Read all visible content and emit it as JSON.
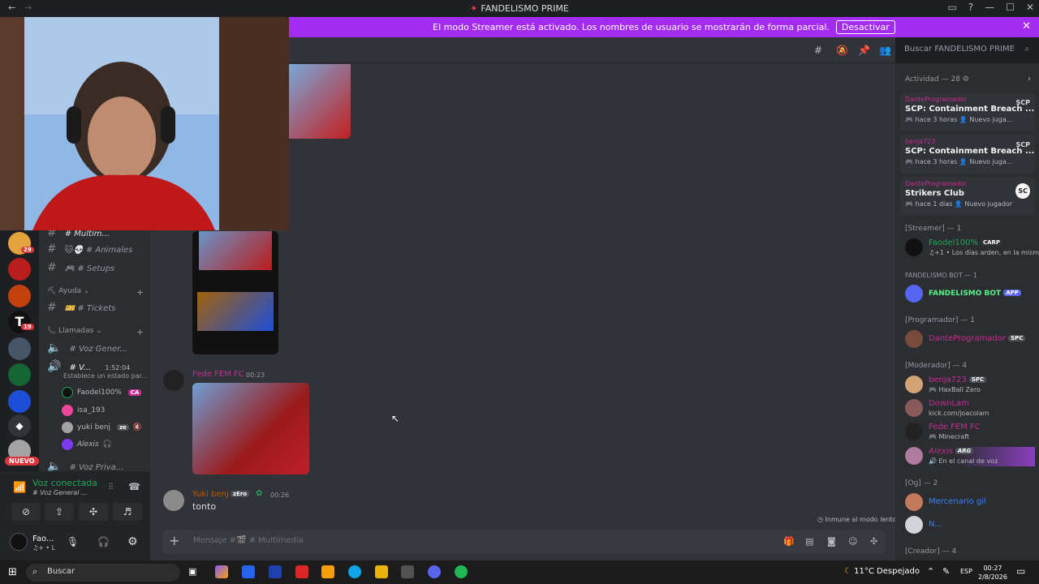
{
  "window": {
    "title": "FANDELISMO PRIME",
    "back": "←",
    "forward": "→",
    "controls": [
      "▭",
      "?",
      "—",
      "☐",
      "✕"
    ]
  },
  "banner": {
    "text": "El modo Streamer está activado. Los nombres de usuario se mostrarán de forma parcial.",
    "button": "Desactivar",
    "close": "✕"
  },
  "servers": {
    "badges": [
      "29",
      "19"
    ],
    "new_label": "NUEVO"
  },
  "channels": {
    "top_partial": "# Multim...",
    "items": [
      {
        "icons": "🐱💀",
        "name": "# Animales"
      },
      {
        "icons": "🎮",
        "name": "# Setups"
      }
    ],
    "category_help": "Ayuda",
    "help_items": [
      {
        "icons": "🎫",
        "name": "# Tickets"
      }
    ],
    "category_calls": "Llamadas",
    "voice_channels": [
      {
        "name": "# Voz Gener...",
        "time": ""
      },
      {
        "name": "# V...",
        "time": "1:52:04"
      }
    ],
    "voice_status_set": "Establece un estado par...",
    "voice_users": [
      {
        "name": "Faodel100%",
        "tag": "CA"
      },
      {
        "name": "isa_193",
        "tag": ""
      },
      {
        "name": "yuki benj",
        "tag": "ze"
      },
      {
        "name": "Alexis",
        "tag": ""
      }
    ],
    "private_channel": "# Voz Priva..."
  },
  "user_panel": {
    "voice_connected": "Voz conectada",
    "voice_channel": "# Voz General ...",
    "self_name": "Fao...",
    "self_status": "♫+ • L"
  },
  "chat": {
    "messages": [
      {
        "author": "Fede FEM FC",
        "time": "00:23",
        "color": "#c72c91"
      },
      {
        "author": "Yuki benj",
        "tag": "zEro",
        "time": "00:26",
        "text": "tonto",
        "color": "#b85b00"
      }
    ],
    "slowmode_notice": "Inmune al modo lento",
    "composer_placeholder": "Mensaje #🎬 # Multimedia",
    "composer_plus": "+"
  },
  "search": {
    "placeholder": "Buscar FANDELISMO PRIME"
  },
  "members": {
    "activity_header": "Actividad — 28 ⚙",
    "activity_cards": [
      {
        "who": "DanteProgramador",
        "game": "SCP: Containment Breach ...",
        "meta": "🎮 hace 3 horas  👤 Nuevo juga...",
        "logo": "SCP"
      },
      {
        "who": "benja723",
        "game": "SCP: Containment Breach ...",
        "meta": "🎮 hace 3 horas  👤 Nuevo juga...",
        "logo": "SCP"
      },
      {
        "who": "DanteProgramador",
        "game": "Strikers Club",
        "meta": "🎮 hace 1 días  👤 Nuevo jugador",
        "logo": "SC"
      }
    ],
    "groups": [
      {
        "label": "[Streamer] — 1"
      },
      {
        "label": "FANDELISMO BOT — 1"
      },
      {
        "label": "[Programador] — 1"
      },
      {
        "label": "[Moderador] — 4"
      },
      {
        "label": "[Og] — 2"
      },
      {
        "label": "[Creador] — 4"
      }
    ],
    "list": [
      {
        "name": "Faodel100%",
        "tag": "CARP",
        "status": "♫+1 • Los días arden, en la misma ...",
        "color": "#23a559"
      },
      {
        "name": "FANDELISMO BOT",
        "tag": "APP",
        "status": "",
        "color": "#57f287"
      },
      {
        "name": "DanteProgramador",
        "tag": "SPC",
        "status": "",
        "color": "#c72c91"
      },
      {
        "name": "benja723",
        "tag": "SPC",
        "status": "🎮 HaxBall Zero",
        "color": "#c72c91"
      },
      {
        "name": "DownLam",
        "tag": "",
        "status": "kick.com/joacolam",
        "color": "#c72c91"
      },
      {
        "name": "Fede FEM FC",
        "tag": "",
        "status": "🎮 Minecraft",
        "color": "#c72c91"
      },
      {
        "name": "Alexis",
        "tag": "ARG",
        "status": "🔊 En el canal de voz",
        "color": "#c72c91"
      },
      {
        "name": "Mercenario gil",
        "tag": "",
        "status": "",
        "color": "#3b82f6"
      },
      {
        "name": "N...",
        "tag": "",
        "status": "",
        "color": "#3b82f6"
      }
    ]
  },
  "taskbar": {
    "search": "Buscar",
    "weather": "11°C  Despejado",
    "lang": "ESP",
    "time": "00:27",
    "date": "2/8/2026"
  }
}
